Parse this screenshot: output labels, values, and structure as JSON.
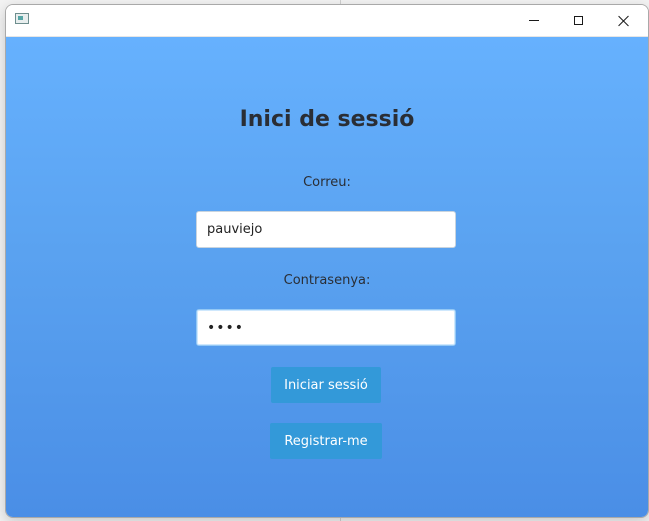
{
  "window": {
    "title": "",
    "controls": {
      "minimize_icon": "minimize-icon",
      "maximize_icon": "maximize-icon",
      "close_icon": "close-icon"
    }
  },
  "login": {
    "title": "Inici de sessió",
    "email_label": "Correu:",
    "email_value": "pauviejo",
    "password_label": "Contrasenya:",
    "password_value": "••••",
    "login_button": "Iniciar sessió",
    "register_button": "Registrar-me"
  },
  "colors": {
    "background_top": "#66b1fe",
    "background_bottom": "#4a8ee6",
    "button": "#3399d9",
    "title_text": "#2a2e35"
  }
}
